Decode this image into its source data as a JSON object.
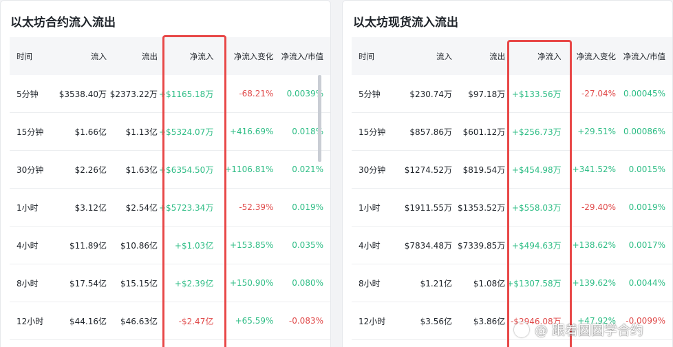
{
  "colors": {
    "positive": "#2ebd85",
    "negative": "#e04a4a",
    "highlight": "#e84848"
  },
  "panels": [
    {
      "title": "以太坊合约流入流出",
      "headers": [
        "时间",
        "流入",
        "流出",
        "净流入",
        "净流入变化",
        "净流入/市值"
      ],
      "rows": [
        {
          "time": "5分钟",
          "inflow": "$3538.40万",
          "outflow": "$2373.22万",
          "net": "+$1165.18万",
          "change": "-68.21%",
          "ratio": "0.0039%"
        },
        {
          "time": "15分钟",
          "inflow": "$1.66亿",
          "outflow": "$1.13亿",
          "net": "+$5324.07万",
          "change": "+416.69%",
          "ratio": "0.018%"
        },
        {
          "time": "30分钟",
          "inflow": "$2.26亿",
          "outflow": "$1.63亿",
          "net": "+$6354.50万",
          "change": "+1106.81%",
          "ratio": "0.021%"
        },
        {
          "time": "1小时",
          "inflow": "$3.12亿",
          "outflow": "$2.54亿",
          "net": "+$5723.34万",
          "change": "-52.39%",
          "ratio": "0.019%"
        },
        {
          "time": "4小时",
          "inflow": "$11.89亿",
          "outflow": "$10.86亿",
          "net": "+$1.03亿",
          "change": "+153.85%",
          "ratio": "0.035%"
        },
        {
          "time": "8小时",
          "inflow": "$17.54亿",
          "outflow": "$15.15亿",
          "net": "+$2.39亿",
          "change": "+150.90%",
          "ratio": "0.080%"
        },
        {
          "time": "12小时",
          "inflow": "$44.16亿",
          "outflow": "$46.63亿",
          "net": "-$2.47亿",
          "change": "+65.59%",
          "ratio": "-0.083%"
        }
      ]
    },
    {
      "title": "以太坊现货流入流出",
      "headers": [
        "时间",
        "流入",
        "流出",
        "净流入",
        "净流入变化",
        "净流入/市值"
      ],
      "rows": [
        {
          "time": "5分钟",
          "inflow": "$230.74万",
          "outflow": "$97.18万",
          "net": "+$133.56万",
          "change": "-27.04%",
          "ratio": "0.00045%"
        },
        {
          "time": "15分钟",
          "inflow": "$857.86万",
          "outflow": "$601.12万",
          "net": "+$256.73万",
          "change": "+29.51%",
          "ratio": "0.00086%"
        },
        {
          "time": "30分钟",
          "inflow": "$1274.52万",
          "outflow": "$819.54万",
          "net": "+$454.98万",
          "change": "+341.52%",
          "ratio": "0.0015%"
        },
        {
          "time": "1小时",
          "inflow": "$1911.55万",
          "outflow": "$1353.52万",
          "net": "+$558.03万",
          "change": "-29.40%",
          "ratio": "0.0019%"
        },
        {
          "time": "4小时",
          "inflow": "$7834.48万",
          "outflow": "$7339.85万",
          "net": "+$494.63万",
          "change": "+138.62%",
          "ratio": "0.0017%"
        },
        {
          "time": "8小时",
          "inflow": "$1.21亿",
          "outflow": "$1.08亿",
          "net": "+$1307.58万",
          "change": "+139.62%",
          "ratio": "0.0044%"
        },
        {
          "time": "12小时",
          "inflow": "$3.56亿",
          "outflow": "$3.86亿",
          "net": "-$2946.08万",
          "change": "+47.92%",
          "ratio": "-0.0099%"
        }
      ]
    }
  ],
  "watermark": {
    "text": "@ 跟着囡囡学合约",
    "icon": "weibo-logo-icon"
  }
}
